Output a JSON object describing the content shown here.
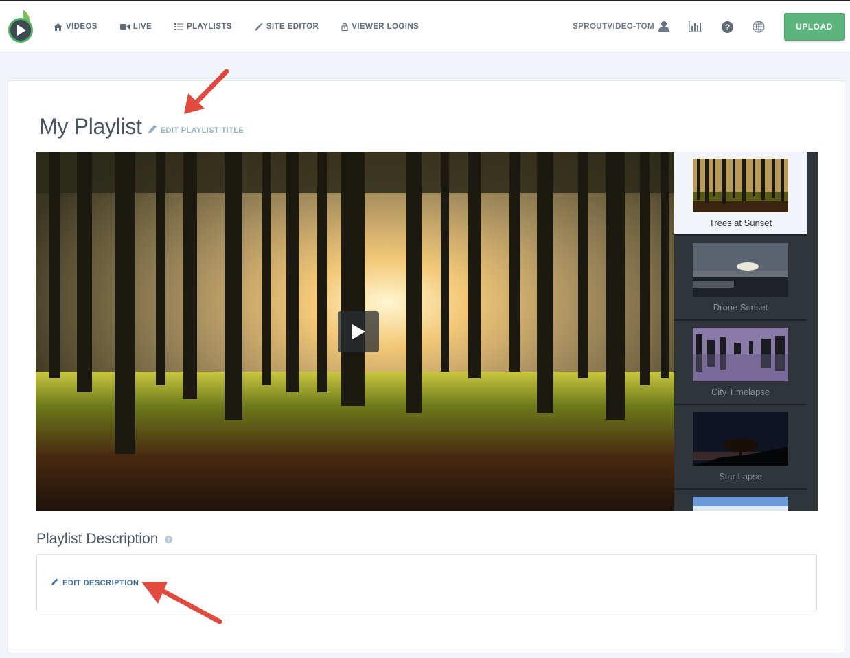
{
  "nav": {
    "items": [
      {
        "label": "VIDEOS",
        "icon": "home-icon"
      },
      {
        "label": "LIVE",
        "icon": "video-camera-icon"
      },
      {
        "label": "PLAYLISTS",
        "icon": "list-icon"
      },
      {
        "label": "SITE EDITOR",
        "icon": "magic-wand-icon"
      },
      {
        "label": "VIEWER LOGINS",
        "icon": "lock-icon"
      }
    ],
    "username": "SPROUTVIDEO-TOM",
    "upload_label": "UPLOAD"
  },
  "colors": {
    "accent_green": "#5cb57c",
    "link_blue": "#3c6ea5",
    "muted_link": "#8fb3c6",
    "annotation_red": "#e04a3f"
  },
  "playlist": {
    "title": "My Playlist",
    "edit_title_label": "EDIT PLAYLIST TITLE",
    "items": [
      {
        "label": "Trees at Sunset",
        "active": true
      },
      {
        "label": "Drone Sunset",
        "active": false
      },
      {
        "label": "City Timelapse",
        "active": false
      },
      {
        "label": "Star Lapse",
        "active": false
      },
      {
        "label": "",
        "active": false
      }
    ]
  },
  "description": {
    "heading": "Playlist Description",
    "edit_label": "EDIT DESCRIPTION"
  }
}
